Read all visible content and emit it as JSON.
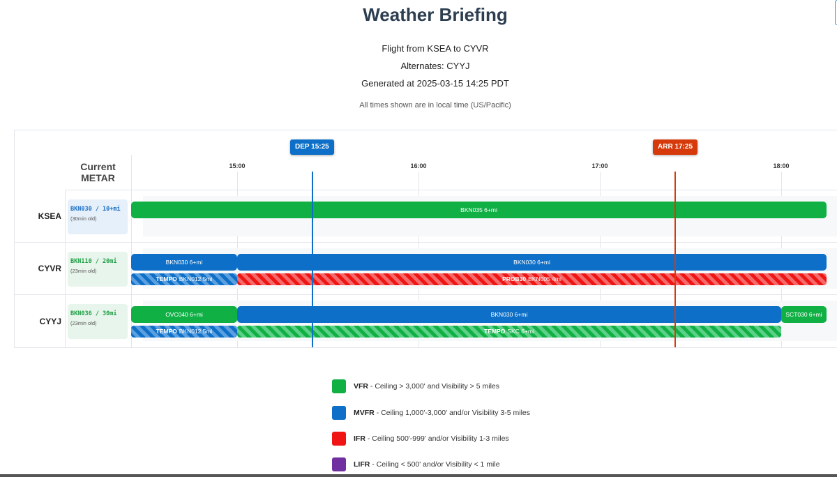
{
  "header": {
    "title": "Weather Briefing",
    "flight": "Flight from KSEA to CYVR",
    "alternates": "Alternates: CYYJ",
    "generated": "Generated at 2025-03-15 14:25 PDT",
    "tz_note": "All times shown are in local time (US/Pacific)"
  },
  "timeline": {
    "metar_header": "Current METAR",
    "ticks": [
      "15:00",
      "16:00",
      "17:00",
      "18:00"
    ],
    "departure_label": "DEP 15:25",
    "arrival_label": "ARR 17:25"
  },
  "airports": [
    {
      "code": "KSEA",
      "metar": {
        "text": "BKN030 / 10+mi",
        "age": "(30min old)",
        "category": "MVFR"
      },
      "forecast": [
        {
          "label": "BKN035 6+mi",
          "category": "VFR"
        }
      ],
      "secondary": []
    },
    {
      "code": "CYVR",
      "metar": {
        "text": "BKN110 / 20mi",
        "age": "(23min old)",
        "category": "VFR"
      },
      "forecast": [
        {
          "label": "BKN030 6+mi",
          "category": "MVFR"
        },
        {
          "label": "BKN030 6+mi",
          "category": "MVFR"
        }
      ],
      "secondary": [
        {
          "type": "TEMPO",
          "label": "BKN012 5mi",
          "category": "MVFR"
        },
        {
          "type": "PROB30",
          "label": "BKN005 4mi",
          "category": "IFR"
        }
      ]
    },
    {
      "code": "CYYJ",
      "metar": {
        "text": "BKN036 / 30mi",
        "age": "(23min old)",
        "category": "VFR"
      },
      "forecast": [
        {
          "label": "OVC040 6+mi",
          "category": "VFR"
        },
        {
          "label": "BKN030 6+mi",
          "category": "MVFR"
        },
        {
          "label": "SCT030 6+mi",
          "category": "VFR"
        }
      ],
      "secondary": [
        {
          "type": "TEMPO",
          "label": "BKN012 5mi",
          "category": "MVFR"
        },
        {
          "type": "TEMPO",
          "label": "SKC 6+mi",
          "category": "VFR"
        }
      ]
    }
  ],
  "legend": [
    {
      "name": "VFR",
      "desc": " - Ceiling > 3,000' and Visibility > 5 miles",
      "color": "#10b045"
    },
    {
      "name": "MVFR",
      "desc": " - Ceiling 1,000'-3,000' and/or Visibility 3-5 miles",
      "color": "#0d6fc7"
    },
    {
      "name": "IFR",
      "desc": " - Ceiling 500'-999' and/or Visibility 1-3 miles",
      "color": "#f01515"
    },
    {
      "name": "LIFR",
      "desc": " - Ceiling < 500' and/or Visibility < 1 mile",
      "color": "#7030a0"
    }
  ],
  "colors": {
    "vfr": "#10b045",
    "mvfr": "#0d6fc7",
    "ifr": "#f01515",
    "lifr": "#7030a0",
    "dep": "#0d6fc7",
    "arr": "#d63a0a"
  }
}
